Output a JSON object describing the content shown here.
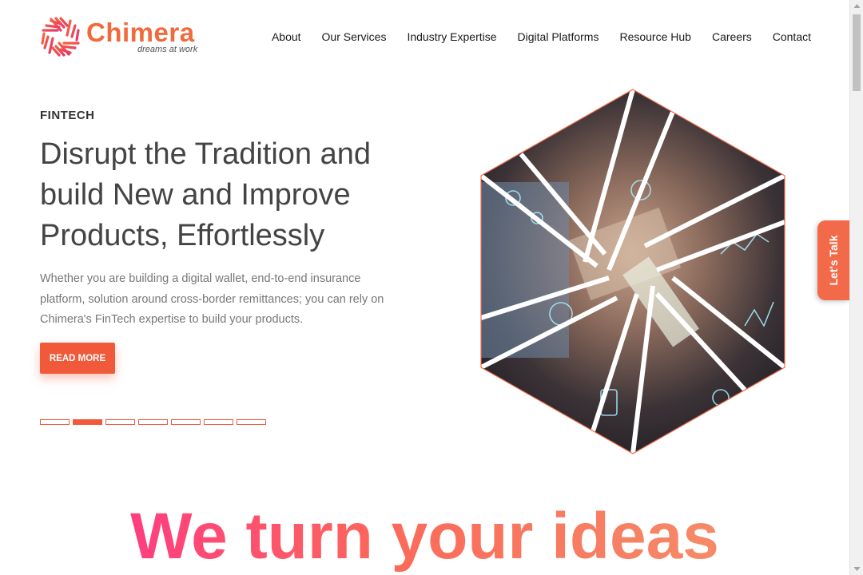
{
  "brand": {
    "name": "Chimera",
    "tagline": "dreams at work",
    "accent": "#f26a3c"
  },
  "nav": {
    "items": [
      "About",
      "Our Services",
      "Industry Expertise",
      "Digital Platforms",
      "Resource Hub",
      "Careers",
      "Contact"
    ]
  },
  "hero": {
    "kicker": "FINTECH",
    "headline": "Disrupt the Tradition and build New and Improve Products, Effortlessly",
    "description": "Whether you are building a digital wallet, end-to-end insurance platform, solution around cross-border remittances; you can rely on Chimera's FinTech expertise to build your products.",
    "cta_label": "READ MORE",
    "slides_total": 7,
    "slide_active": 2
  },
  "side_tab": {
    "label": "Let's Talk"
  },
  "section": {
    "title": "We turn your ideas"
  },
  "colors": {
    "cta": "#f05a3a",
    "gradient_start": "#ff3d7f",
    "gradient_end": "#f58a68"
  }
}
